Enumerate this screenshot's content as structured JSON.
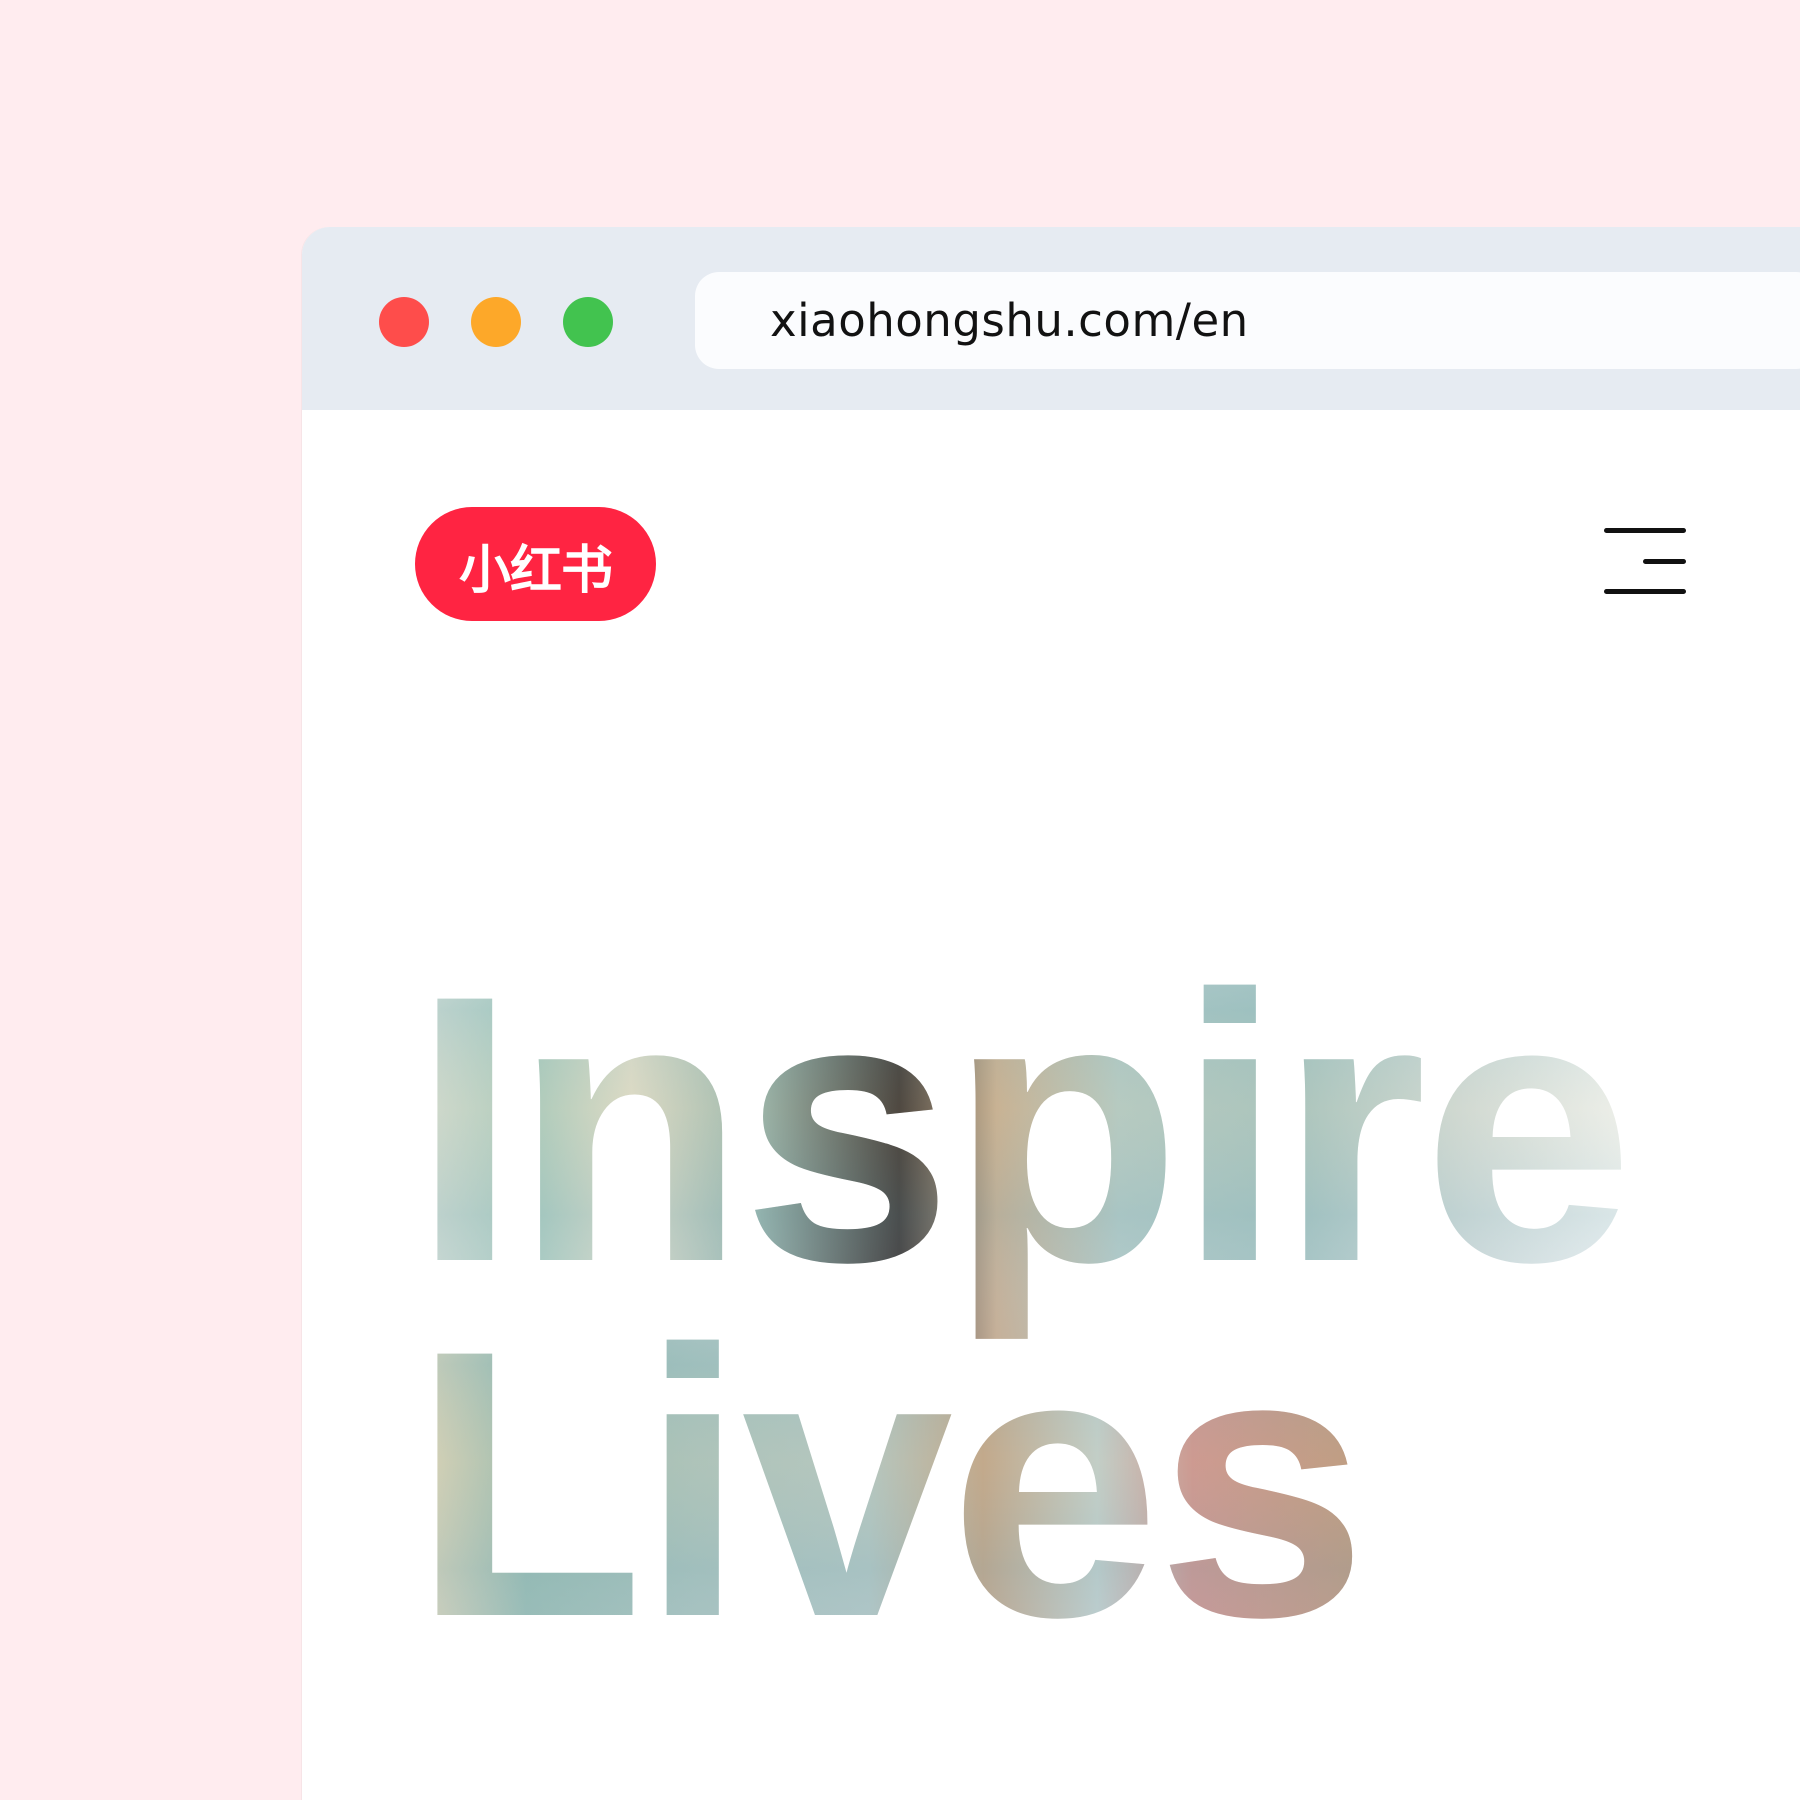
{
  "browser": {
    "url": "xiaohongshu.com/en",
    "traffic_lights": {
      "close_color": "#fe4d4b",
      "minimize_color": "#fda829",
      "maximize_color": "#42c34f"
    }
  },
  "header": {
    "logo_text": "小红书",
    "logo_color": "#ff2442",
    "menu_icon": "hamburger-menu-icon"
  },
  "hero": {
    "line1": "Inspire",
    "line2": "Lives",
    "fill_style": "photo-texture-knockout"
  },
  "theme": {
    "page_background": "#ffecef",
    "chrome_background": "#e6ebf2",
    "address_bar_background": "#fbfcfe",
    "content_background": "#ffffff"
  }
}
